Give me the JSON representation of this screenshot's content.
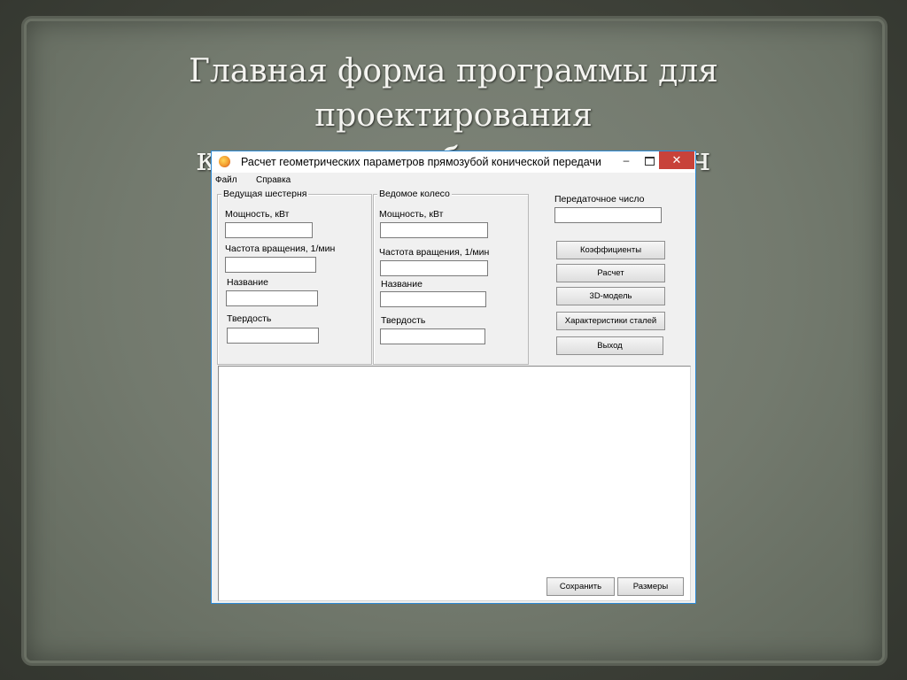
{
  "slide": {
    "title_line1": "Главная форма программы для проектирования",
    "title_line2": "конических зубчатых передач"
  },
  "window": {
    "title": "Расчет геометрических параметров прямозубой конической передачи",
    "controls": {
      "minimize": "–",
      "close": "✕"
    }
  },
  "menu": [
    "Файл",
    "Справка"
  ],
  "driving_gear": {
    "legend": "Ведущая шестерня",
    "power_label": "Мощность, кВт",
    "speed_label": "Частота вращения, 1/мин",
    "name_label": "Название",
    "hardness_label": "Твердость",
    "power_value": "",
    "speed_value": "",
    "name_value": "",
    "hardness_value": ""
  },
  "driven_gear": {
    "legend": "Ведомое колесо",
    "power_label": "Мощность, кВт",
    "speed_label": "Частота вращения, 1/мин",
    "name_label": "Название",
    "hardness_label": "Твердость",
    "power_value": "",
    "speed_value": "",
    "name_value": "",
    "hardness_value": ""
  },
  "ratio": {
    "label": "Передаточное число",
    "value": ""
  },
  "buttons": {
    "coefficients": "Коэффициенты",
    "calculate": "Расчет",
    "model3d": "3D-модель",
    "steel_props": "Характеристики сталей",
    "exit": "Выход",
    "save": "Сохранить",
    "sizes": "Размеры"
  },
  "output_text": "",
  "colors": {
    "window_border": "#2c8ad6",
    "close_button": "#c8423a",
    "form_bg": "#f0f0f0"
  }
}
